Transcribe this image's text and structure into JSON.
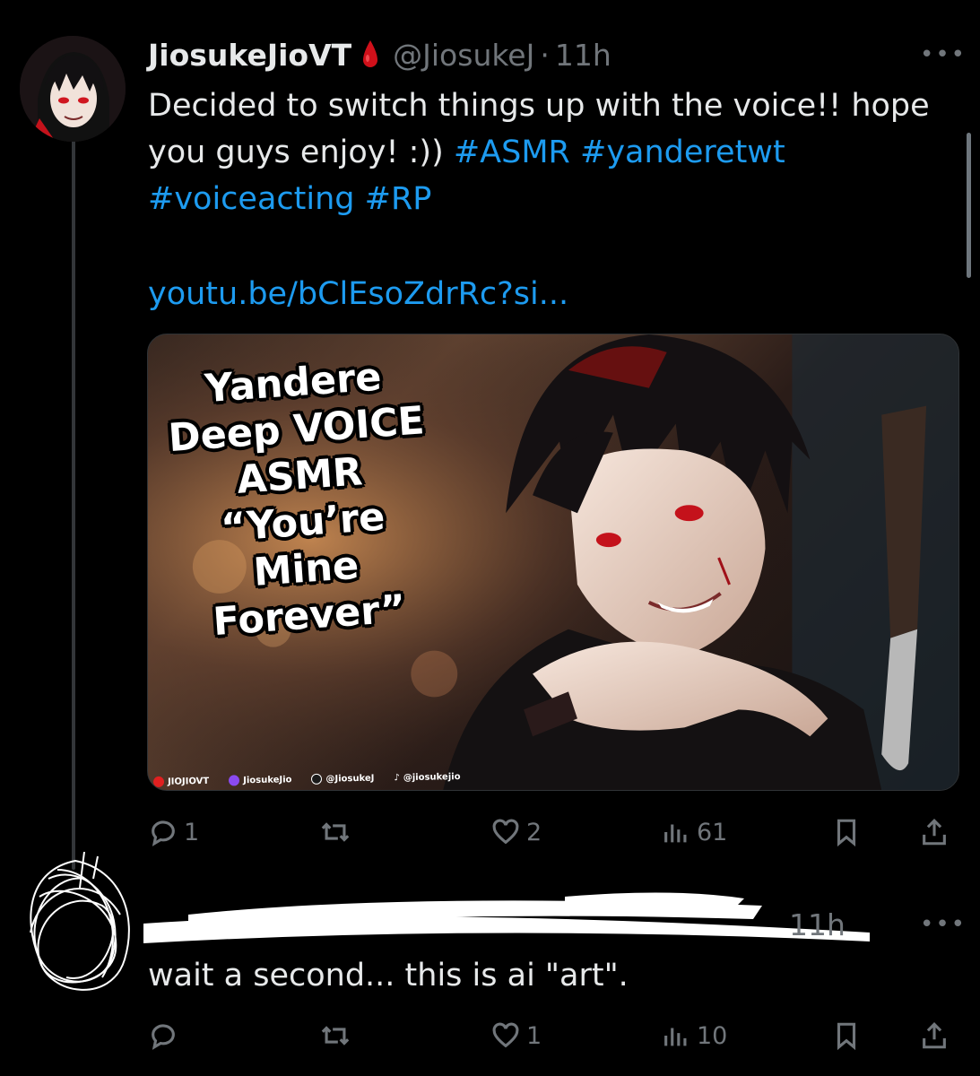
{
  "tweet": {
    "display_name": "JiosukeJioVT",
    "handle": "@JiosukeJ",
    "separator": "·",
    "time": "11h",
    "text_plain_1": "Decided to switch things up with the voice!! hope you guys enjoy! :)) ",
    "hashtags": [
      "#ASMR",
      "#yanderetwt",
      "#voiceacting",
      "#RP"
    ],
    "link": "youtu.be/bClEsoZdrRc?si...",
    "thumbnail": {
      "title_lines": [
        "Yandere",
        "Deep VOICE",
        "ASMR",
        "“You’re",
        "Mine",
        "Forever”"
      ],
      "socials": [
        "JIOJIOVT",
        "JiosukeJio",
        "@JiosukeJ",
        "@jiosukejio"
      ]
    },
    "actions": {
      "replies": "1",
      "retweets": "",
      "likes": "2",
      "views": "61"
    }
  },
  "reply": {
    "time_fragment": "11h",
    "text": "wait a second... this is ai \"art\".",
    "actions": {
      "replies": "",
      "retweets": "",
      "likes": "1",
      "views": "10"
    }
  },
  "colors": {
    "background": "#000000",
    "text": "#e7e9ea",
    "muted": "#71767b",
    "link": "#1d9bf0",
    "blood_red": "#d0101a"
  },
  "icons": [
    "reply-icon",
    "retweet-icon",
    "heart-icon",
    "views-icon",
    "bookmark-icon",
    "share-icon",
    "more-icon",
    "blood-drop-icon"
  ]
}
